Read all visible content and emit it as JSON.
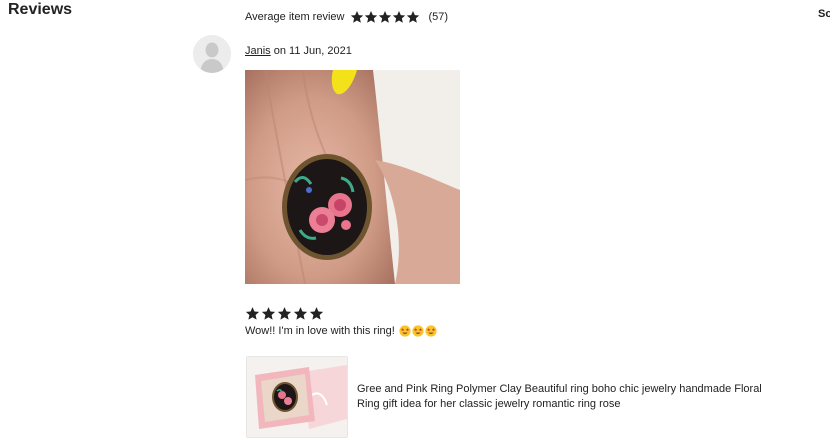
{
  "section_title": "Reviews",
  "sort_label": "So",
  "summary": {
    "label": "Average item review",
    "rating": 5,
    "count_text": "(57)"
  },
  "review": {
    "author": "Janis",
    "date_text": "on 11 Jun, 2021",
    "rating": 5,
    "text": "Wow!! I'm in love with this ring!",
    "emojis": [
      "star-struck-emoji",
      "star-struck-emoji",
      "star-struck-emoji"
    ]
  },
  "product": {
    "title": "Gree and Pink Ring Polymer Clay Beautiful ring boho chic jewelry handmade Floral Ring gift idea for her classic jewelry romantic ring rose"
  },
  "colors": {
    "star": "#222222",
    "text": "#222222",
    "avatar_bg": "#ececec"
  }
}
